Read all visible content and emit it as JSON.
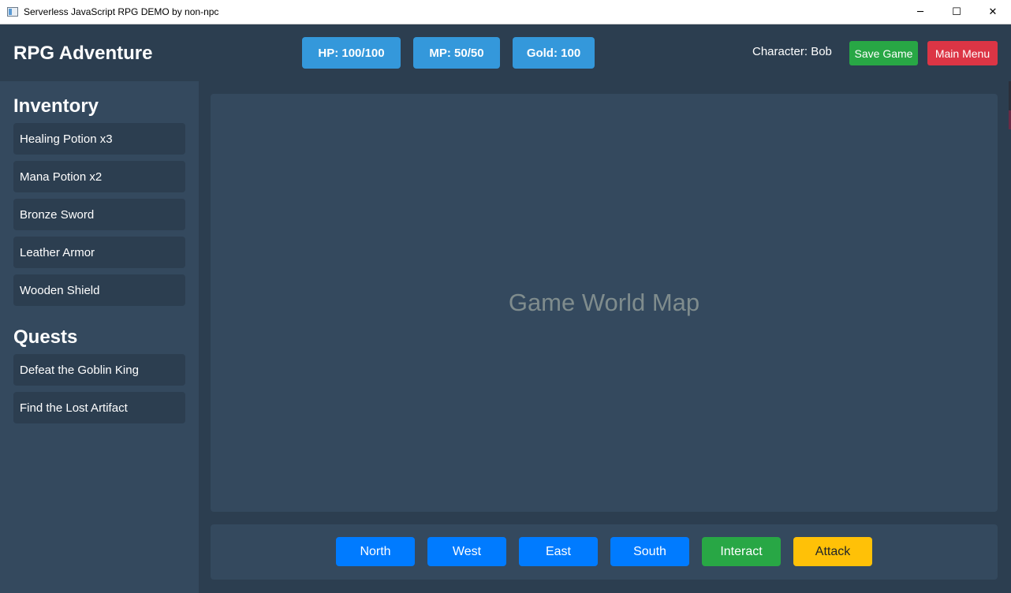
{
  "window": {
    "title": "Serverless JavaScript RPG DEMO by non-npc",
    "minimize_glyph": "─",
    "maximize_glyph": "☐",
    "close_glyph": "✕"
  },
  "header": {
    "brand": "RPG Adventure",
    "stats": {
      "hp": "HP: 100/100",
      "mp": "MP: 50/50",
      "gold": "Gold: 100"
    },
    "character": "Character: Bob",
    "save_label": "Save Game",
    "menu_label": "Main Menu"
  },
  "sidebar": {
    "inventory_title": "Inventory",
    "inventory": [
      "Healing Potion x3",
      "Mana Potion x2",
      "Bronze Sword",
      "Leather Armor",
      "Wooden Shield"
    ],
    "quests_title": "Quests",
    "quests": [
      "Defeat the Goblin King",
      "Find the Lost Artifact"
    ]
  },
  "main": {
    "map_label": "Game World Map",
    "controls": {
      "north": "North",
      "west": "West",
      "east": "East",
      "south": "South",
      "interact": "Interact",
      "attack": "Attack"
    }
  },
  "colors": {
    "background": "#2c3e50",
    "panel": "#34495e",
    "stat_blue": "#3498db",
    "move_blue": "#007bff",
    "green": "#28a745",
    "red": "#dc3545",
    "yellow": "#ffc107"
  },
  "icons": {
    "app": "app-window-icon",
    "minimize": "minimize-icon",
    "maximize": "maximize-icon",
    "close": "close-icon"
  }
}
